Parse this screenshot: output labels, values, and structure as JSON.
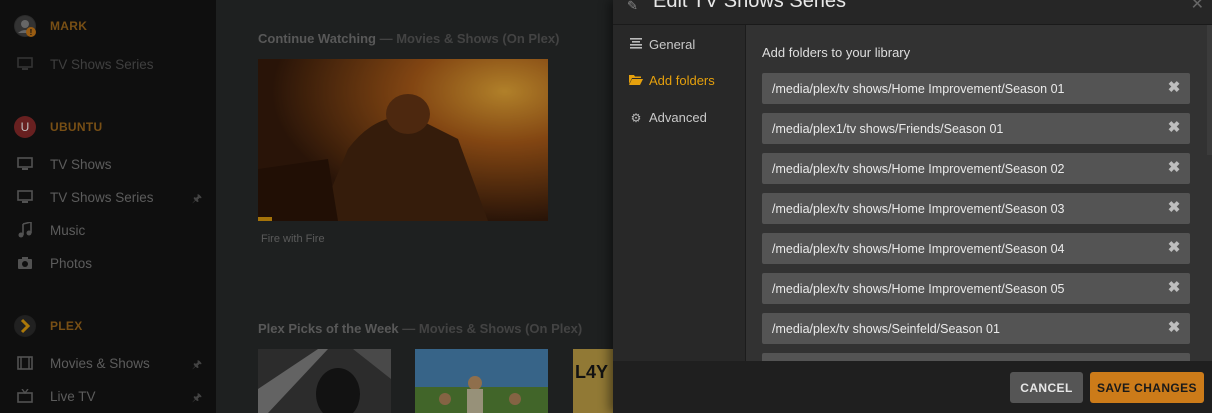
{
  "sidebar": {
    "servers": [
      {
        "name": "MARK",
        "icon": "user-warning-icon"
      },
      {
        "name": "UBUNTU",
        "icon": "server-u-icon",
        "initial": "U"
      },
      {
        "name": "PLEX",
        "icon": "plex-chevron-icon"
      }
    ],
    "items": [
      {
        "label": "TV Shows Series",
        "icon": "monitor-icon"
      },
      {
        "label": "TV Shows",
        "icon": "monitor-icon"
      },
      {
        "label": "TV Shows Series",
        "icon": "monitor-icon"
      },
      {
        "label": "Music",
        "icon": "music-note-icon"
      },
      {
        "label": "Photos",
        "icon": "camera-icon"
      },
      {
        "label": "Movies & Shows",
        "icon": "film-icon"
      },
      {
        "label": "Live TV",
        "icon": "tv-icon"
      }
    ]
  },
  "main": {
    "continue_watching": {
      "title": "Continue Watching",
      "subtitle": "— Movies & Shows (On Plex)",
      "item_caption": "Fire with Fire"
    },
    "plex_picks": {
      "title": "Plex Picks of the Week",
      "subtitle": "— Movies & Shows (On Plex)"
    }
  },
  "modal": {
    "title": "Edit TV Shows Series",
    "nav": [
      {
        "label": "General",
        "icon": "lines-icon"
      },
      {
        "label": "Add folders",
        "icon": "folder-icon"
      },
      {
        "label": "Advanced",
        "icon": "gear-icon"
      }
    ],
    "heading": "Add folders to your library",
    "folders": [
      "/media/plex/tv shows/Home Improvement/Season 01",
      "/media/plex1/tv shows/Friends/Season 01",
      "/media/plex/tv shows/Home Improvement/Season 02",
      "/media/plex/tv shows/Home Improvement/Season 03",
      "/media/plex/tv shows/Home Improvement/Season 04",
      "/media/plex/tv shows/Home Improvement/Season 05",
      "/media/plex/tv shows/Seinfeld/Season 01"
    ],
    "cancel_label": "CANCEL",
    "save_label": "SAVE CHANGES"
  },
  "colors": {
    "accent": "#e5a00d",
    "save_button": "#cc7b19",
    "server_label": "#a06a1c"
  }
}
